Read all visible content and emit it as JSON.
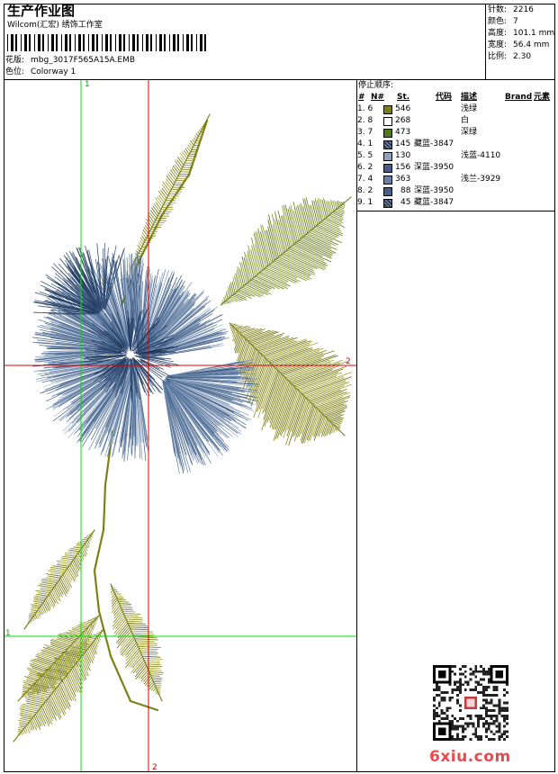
{
  "header": {
    "title": "生产作业图",
    "studio": "Wilcom(汇宏) 绣饰工作室",
    "pattern_label": "花版:",
    "pattern_value": "mbg_3017F565A15A.EMB",
    "colorway_label": "色位:",
    "colorway_value": "Colorway 1"
  },
  "specs": [
    {
      "label": "针数:",
      "value": "2216"
    },
    {
      "label": "颜色:",
      "value": "7"
    },
    {
      "label": "高度:",
      "value": "101.1 mm"
    },
    {
      "label": "宽度:",
      "value": "56.4 mm"
    },
    {
      "label": "比例:",
      "value": "2.30"
    }
  ],
  "stop_sequence": {
    "title": "停止顺序:",
    "columns": {
      "hash": "#",
      "n": "N#",
      "st": "St.",
      "code": "代码",
      "desc": "描述",
      "brand": "Brand",
      "element": "元素"
    },
    "rows": [
      {
        "seq": "1. 6",
        "st": "546",
        "code": "",
        "desc": "浅绿",
        "color": "#7c7f14",
        "pattern": false
      },
      {
        "seq": "2. 8",
        "st": "268",
        "code": "",
        "desc": "白",
        "color": "#ffffff",
        "pattern": false
      },
      {
        "seq": "3. 7",
        "st": "473",
        "code": "",
        "desc": "深绿",
        "color": "#4f7a18",
        "pattern": false
      },
      {
        "seq": "4. 1",
        "st": "145",
        "code": "藏蓝-3847",
        "desc": "",
        "color": "#233a5c",
        "pattern": true
      },
      {
        "seq": "5. 5",
        "st": "130",
        "code": "",
        "desc": "浅蓝-4110",
        "color": "#8fa2bb",
        "pattern": false
      },
      {
        "seq": "6. 2",
        "st": "156",
        "code": "深蓝-3950",
        "desc": "",
        "color": "#465f86",
        "pattern": false
      },
      {
        "seq": "7. 4",
        "st": "363",
        "code": "",
        "desc": "浅兰-3929",
        "color": "#6880a2",
        "pattern": false
      },
      {
        "seq": "8. 2",
        "st": "88",
        "code": "深蓝-3950",
        "desc": "",
        "color": "#465f86",
        "pattern": false
      },
      {
        "seq": "9. 1",
        "st": "45",
        "code": "藏蓝-3847",
        "desc": "",
        "color": "#233a5c",
        "pattern": true
      }
    ]
  },
  "guides": {
    "v1": "1",
    "h1": "1",
    "v2": "2",
    "h2": "2"
  },
  "watermark": "6xiu.com",
  "colors": {
    "guide_green": "#00dd00",
    "guide_red": "#dd0000",
    "watermark": "#e8494f"
  }
}
